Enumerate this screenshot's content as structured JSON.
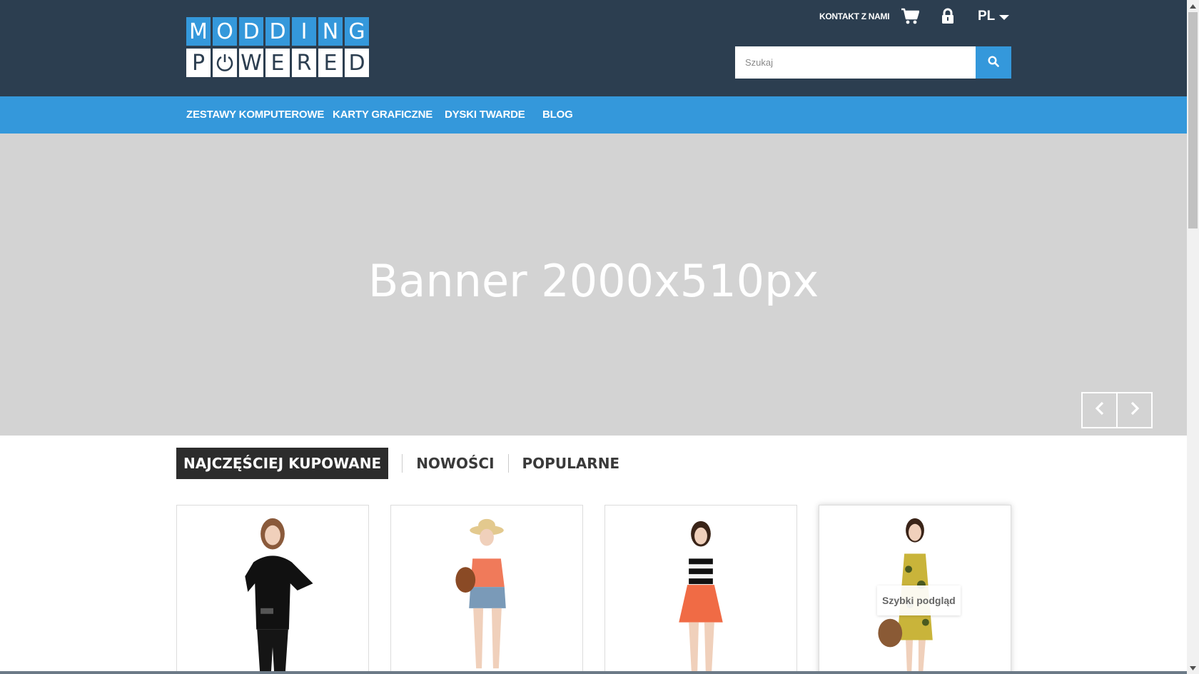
{
  "header": {
    "logo": {
      "top_letters": [
        "M",
        "O",
        "D",
        "D",
        "I",
        "N",
        "G"
      ],
      "bottom_letters": [
        "P",
        "⏻",
        "W",
        "E",
        "R",
        "E",
        "D"
      ]
    },
    "contact_label": "KONTAKT Z NAMI",
    "language": "PL",
    "search": {
      "placeholder": "Szukaj"
    },
    "icons": [
      "cart-icon",
      "lock-icon",
      "search-icon"
    ]
  },
  "nav": {
    "items": [
      {
        "label": "ZESTAWY KOMPUTEROWE"
      },
      {
        "label": "KARTY GRAFICZNE"
      },
      {
        "label": "DYSKI TWARDE"
      },
      {
        "label": "BLOG"
      }
    ]
  },
  "banner": {
    "text": "Banner 2000x510px",
    "controls": [
      "chevron-left-icon",
      "chevron-right-icon"
    ]
  },
  "tabs": [
    {
      "label": "NAJCZĘŚCIEJ KUPOWANE",
      "active": true
    },
    {
      "label": "NOWOŚCI",
      "active": false
    },
    {
      "label": "POPULARNE",
      "active": false
    }
  ],
  "products": [
    {
      "image": "woman in black ruffle top and black pants"
    },
    {
      "image": "woman in straw hat, coral top and denim shorts with brown bag"
    },
    {
      "image": "woman in striped top and orange skirt"
    },
    {
      "image": "woman in yellow floral dress with brown bag",
      "quick_view_label": "Szybki podgląd"
    }
  ],
  "colors": {
    "header_bg": "#2c3e50",
    "accent": "#3498db",
    "banner_bg": "#d3d3d3",
    "active_tab_bg": "#2c2c2c"
  }
}
